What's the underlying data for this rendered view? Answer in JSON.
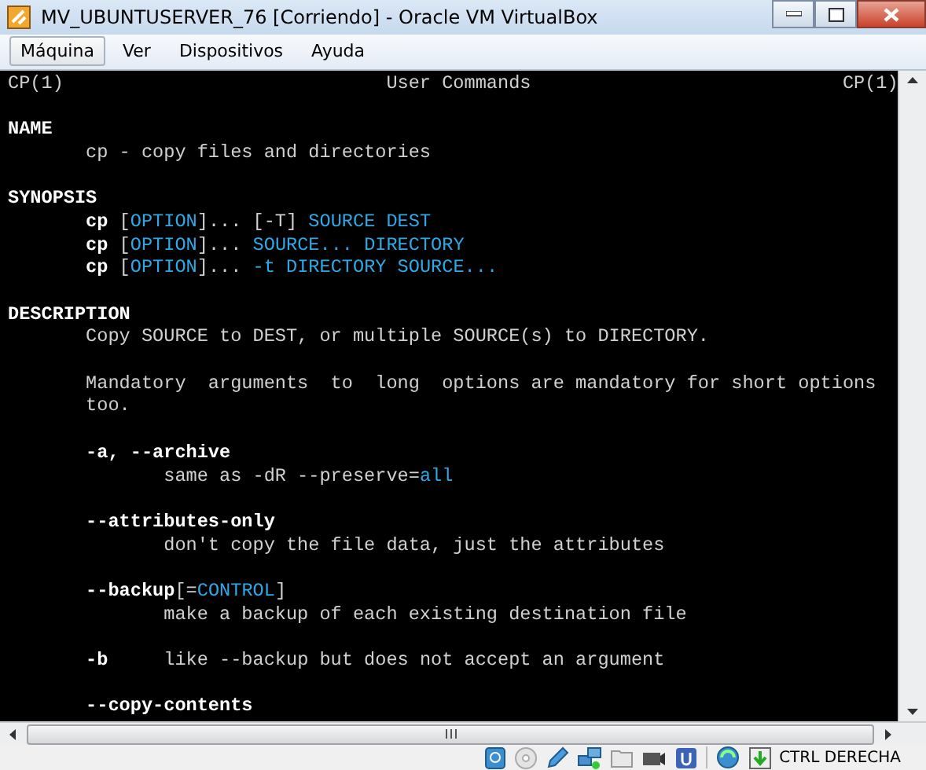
{
  "window": {
    "title": "MV_UBUNTUSERVER_76 [Corriendo] - Oracle VM VirtualBox"
  },
  "menu": [
    {
      "label": "Máquina",
      "selected": true
    },
    {
      "label": "Ver",
      "selected": false
    },
    {
      "label": "Dispositivos",
      "selected": false
    },
    {
      "label": "Ayuda",
      "selected": false
    }
  ],
  "terminal": {
    "blocks": [
      [
        [
          {
            "text": "CP(1)                             User Commands                            CP(1)",
            "kind": "plain"
          }
        ]
      ],
      [
        [
          {
            "text": "NAME",
            "kind": "bold"
          }
        ],
        [
          {
            "text": "       cp - copy files and directories",
            "kind": "plain"
          }
        ]
      ],
      [
        [
          {
            "text": "SYNOPSIS",
            "kind": "bold"
          }
        ],
        [
          {
            "text": "       cp",
            "kind": "bold"
          },
          {
            "text": " [",
            "kind": "plain"
          },
          {
            "text": "OPTION",
            "kind": "link"
          },
          {
            "text": "]... [-T] ",
            "kind": "plain"
          },
          {
            "text": "SOURCE DEST",
            "kind": "link"
          }
        ],
        [
          {
            "text": "       cp",
            "kind": "bold"
          },
          {
            "text": " [",
            "kind": "plain"
          },
          {
            "text": "OPTION",
            "kind": "link"
          },
          {
            "text": "]... ",
            "kind": "plain"
          },
          {
            "text": "SOURCE... DIRECTORY",
            "kind": "link"
          }
        ],
        [
          {
            "text": "       cp",
            "kind": "bold"
          },
          {
            "text": " [",
            "kind": "plain"
          },
          {
            "text": "OPTION",
            "kind": "link"
          },
          {
            "text": "]... ",
            "kind": "plain"
          },
          {
            "text": "-t DIRECTORY SOURCE...",
            "kind": "link"
          }
        ]
      ],
      [
        [
          {
            "text": "DESCRIPTION",
            "kind": "bold"
          }
        ],
        [
          {
            "text": "       Copy SOURCE to DEST, or multiple SOURCE(s) to DIRECTORY.",
            "kind": "plain"
          }
        ]
      ],
      [
        [
          {
            "text": "       Mandatory  arguments  to  long  options are mandatory for short options",
            "kind": "plain"
          }
        ],
        [
          {
            "text": "       too.",
            "kind": "plain"
          }
        ]
      ],
      [
        [
          {
            "text": "       -a, --archive",
            "kind": "bold"
          }
        ],
        [
          {
            "text": "              same as -dR --preserve=",
            "kind": "plain"
          },
          {
            "text": "all",
            "kind": "link"
          }
        ]
      ],
      [
        [
          {
            "text": "       --attributes-only",
            "kind": "bold"
          }
        ],
        [
          {
            "text": "              don't copy the file data, just the attributes",
            "kind": "plain"
          }
        ]
      ],
      [
        [
          {
            "text": "       --backup",
            "kind": "bold"
          },
          {
            "text": "[=",
            "kind": "plain"
          },
          {
            "text": "CONTROL",
            "kind": "link"
          },
          {
            "text": "]",
            "kind": "plain"
          }
        ],
        [
          {
            "text": "              make a backup of each existing destination file",
            "kind": "plain"
          }
        ]
      ],
      [
        [
          {
            "text": "       -b",
            "kind": "bold"
          },
          {
            "text": "     like --backup but does not accept an argument",
            "kind": "plain"
          }
        ]
      ],
      [
        [
          {
            "text": "       --copy-contents",
            "kind": "bold"
          }
        ]
      ]
    ]
  },
  "status_bar": {
    "host_key": "CTRL DERECHA"
  }
}
